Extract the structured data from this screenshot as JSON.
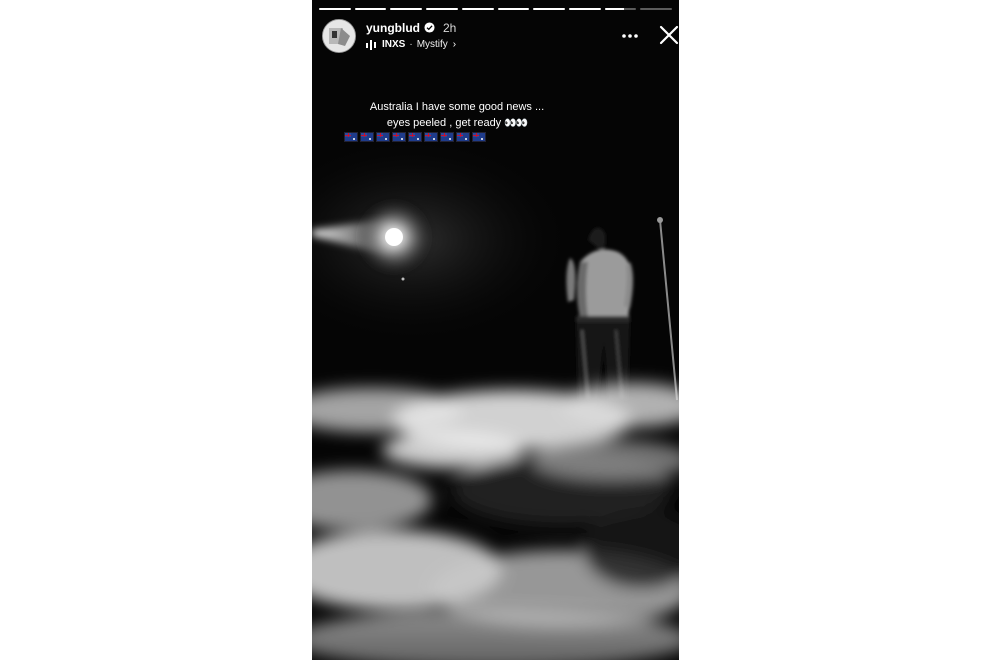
{
  "story": {
    "progress": [
      1,
      1,
      1,
      1,
      1,
      1,
      1,
      1,
      0.6,
      0
    ],
    "account": {
      "username": "yungblud",
      "verified": true,
      "time_ago": "2h",
      "avatar": "avatar-icon"
    },
    "music": {
      "icon": "audio-bars-icon",
      "artist": "INXS",
      "separator": "·",
      "song": "Mystify",
      "chevron": "›"
    },
    "actions": {
      "more": "more-options-icon",
      "close": "close-icon"
    },
    "caption": {
      "line1": "Australia I have some good news ...",
      "line2": "eyes peeled , get ready",
      "eyes_emoji": "👀👀",
      "flag_count": 9,
      "flag_name": "australia-flag-icon"
    },
    "colors": {
      "background": "#050505",
      "text": "#ffffff"
    }
  }
}
